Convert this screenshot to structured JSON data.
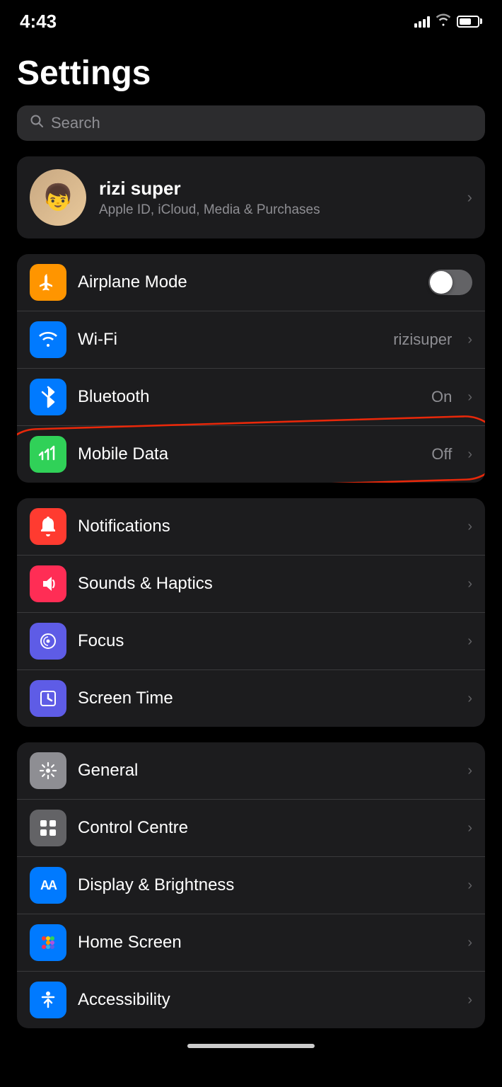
{
  "statusBar": {
    "time": "4:43",
    "signal": 4,
    "wifi": true,
    "battery": 65
  },
  "page": {
    "title": "Settings"
  },
  "search": {
    "placeholder": "Search"
  },
  "profile": {
    "name": "rizi super",
    "subtitle": "Apple ID, iCloud, Media & Purchases",
    "chevron": "›"
  },
  "connectivityGroup": [
    {
      "id": "airplane-mode",
      "label": "Airplane Mode",
      "icon": "✈",
      "iconClass": "icon-airplane",
      "type": "toggle",
      "toggleOn": false
    },
    {
      "id": "wifi",
      "label": "Wi-Fi",
      "icon": "📶",
      "iconClass": "icon-wifi",
      "type": "value",
      "value": "rizisuper"
    },
    {
      "id": "bluetooth",
      "label": "Bluetooth",
      "icon": "✱",
      "iconClass": "icon-bluetooth",
      "type": "value",
      "value": "On"
    },
    {
      "id": "mobile-data",
      "label": "Mobile Data",
      "icon": "📡",
      "iconClass": "icon-mobiledata",
      "type": "value",
      "value": "Off",
      "circled": true
    }
  ],
  "notificationsGroup": [
    {
      "id": "notifications",
      "label": "Notifications",
      "icon": "🔔",
      "iconClass": "icon-notifications"
    },
    {
      "id": "sounds-haptics",
      "label": "Sounds & Haptics",
      "icon": "🔊",
      "iconClass": "icon-sounds"
    },
    {
      "id": "focus",
      "label": "Focus",
      "icon": "🌙",
      "iconClass": "icon-focus"
    },
    {
      "id": "screen-time",
      "label": "Screen Time",
      "icon": "⌛",
      "iconClass": "icon-screentime"
    }
  ],
  "generalGroup": [
    {
      "id": "general",
      "label": "General",
      "icon": "⚙",
      "iconClass": "icon-general"
    },
    {
      "id": "control-centre",
      "label": "Control Centre",
      "icon": "⊞",
      "iconClass": "icon-control"
    },
    {
      "id": "display-brightness",
      "label": "Display & Brightness",
      "icon": "AA",
      "iconClass": "icon-display",
      "iconText": true
    },
    {
      "id": "home-screen",
      "label": "Home Screen",
      "icon": "⠿",
      "iconClass": "icon-homescreen"
    },
    {
      "id": "accessibility",
      "label": "Accessibility",
      "icon": "♿",
      "iconClass": "icon-accessibility"
    }
  ],
  "chevron": "›"
}
